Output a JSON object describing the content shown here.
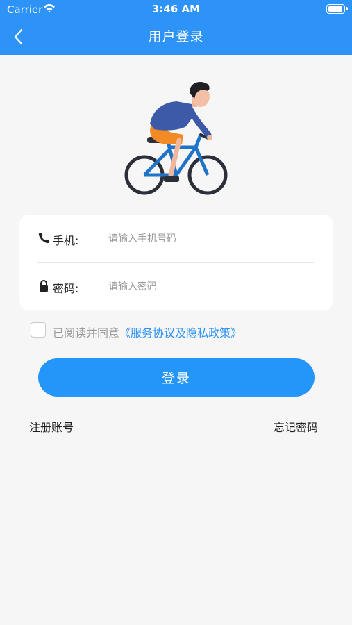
{
  "status_bar": {
    "carrier": "Carrier",
    "time": "3:46 AM"
  },
  "nav": {
    "title": "用户登录",
    "back_icon": "chevron-left-icon",
    "background": "#2e93f7"
  },
  "illustration": {
    "icon": "cyclist-illustration"
  },
  "form": {
    "phone": {
      "label": "手机:",
      "placeholder": "请输入手机号码",
      "icon": "phone-icon"
    },
    "password": {
      "label": "密码:",
      "placeholder": "请输入密码",
      "icon": "lock-icon"
    }
  },
  "agreement": {
    "checked": false,
    "text": "已阅读并同意",
    "link": "《服务协议及隐私政策》",
    "link_color": "#2e93f7"
  },
  "login_button": {
    "label": "登录",
    "color": "#2495f9"
  },
  "links": {
    "register": "注册账号",
    "forgot": "忘记密码"
  }
}
